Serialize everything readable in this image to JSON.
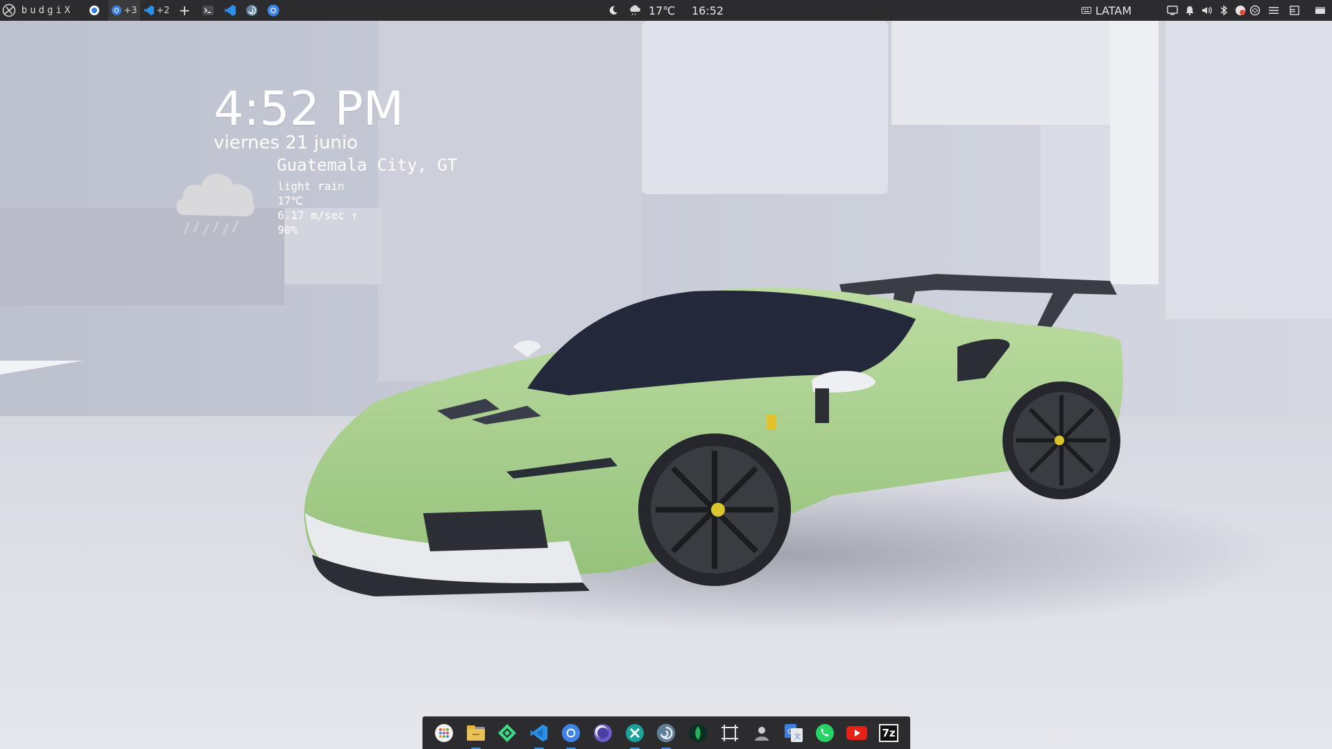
{
  "top_panel": {
    "brand_label": "budgiX",
    "workspace_1_count": "+3",
    "workspace_2_count": "+2",
    "add_workspace_label": "+",
    "weather_temp": "17℃",
    "clock": "16:52",
    "keyboard_layout": "LATAM",
    "icons": [
      "budgie-logo-icon",
      "app-indicator-icon",
      "chrome-icon",
      "vscode-icon",
      "add-icon",
      "terminal-icon",
      "vscode-icon",
      "debian-swirl-icon",
      "chrome-icon",
      "night-mode-icon",
      "cloud-rain-icon",
      "keyboard-icon",
      "screen-icon",
      "bell-icon",
      "volume-icon",
      "bluetooth-icon",
      "network-icon",
      "vpn-icon",
      "menu-icon",
      "raven-icon",
      "show-desktop-icon"
    ]
  },
  "desktop_widget": {
    "time": "4:52 PM",
    "date": "viernes 21 junio",
    "city": "Guatemala City, GT",
    "condition": "light rain",
    "temperature": "17℃",
    "wind": "6.17 m/sec ↑",
    "humidity": "90%",
    "icon": "rain-cloud-icon"
  },
  "dock": {
    "items": [
      {
        "name": "app-grid-icon"
      },
      {
        "name": "files-icon"
      },
      {
        "name": "android-studio-icon"
      },
      {
        "name": "vscode-icon"
      },
      {
        "name": "chrome-icon"
      },
      {
        "name": "eclipse-icon"
      },
      {
        "name": "app-x-icon"
      },
      {
        "name": "debian-swirl-icon"
      },
      {
        "name": "mongodb-icon"
      },
      {
        "name": "screenshot-icon"
      },
      {
        "name": "user-icon"
      },
      {
        "name": "translate-icon"
      },
      {
        "name": "whatsapp-icon"
      },
      {
        "name": "youtube-icon"
      },
      {
        "name": "sevenzip-icon",
        "label": "7z"
      }
    ]
  },
  "colors": {
    "panel_bg": "#2c2c2e",
    "wallpaper_bg": "#c9ccd7",
    "car_green": "#a8cf8e",
    "accent_blue": "#3d8fe6"
  }
}
